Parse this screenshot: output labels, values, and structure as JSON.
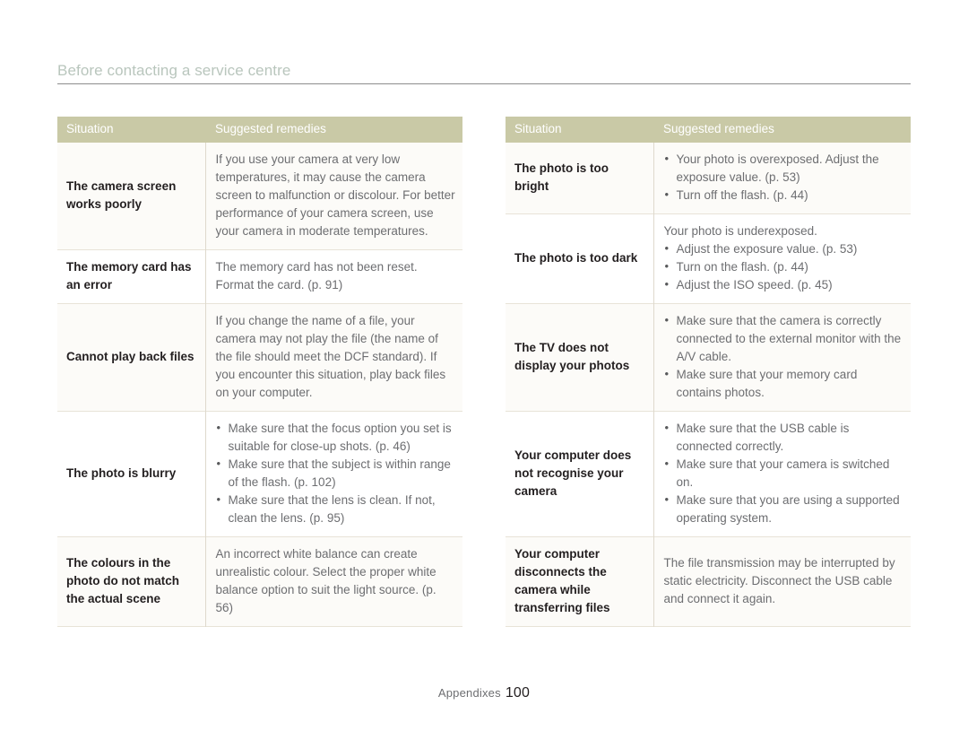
{
  "header": {
    "title": "Before contacting a service centre",
    "rule_color": "#8c8c8c",
    "title_color": "#b9c6bd"
  },
  "theme": {
    "table_header_bg": "#c9c9a6",
    "table_header_text": "#ffffff",
    "situation_text": "#231f20",
    "remedy_text": "#6d6e71",
    "row_divider": "#e8e3d8",
    "alt_row_bg": "#fcfbf8"
  },
  "tables": [
    {
      "id": "left-table",
      "columns": [
        "Situation",
        "Suggested remedies"
      ],
      "rows": [
        {
          "situation": "The camera screen works poorly",
          "remedy_lead": "If you use your camera at very low temperatures, it may cause the camera screen to malfunction or discolour. For better performance of your camera screen, use your camera in moderate temperatures.",
          "remedy_bullets": []
        },
        {
          "situation": "The memory card has an error",
          "remedy_lead": "The memory card has not been reset. Format the card. (p. 91)",
          "remedy_bullets": []
        },
        {
          "situation": "Cannot play back files",
          "remedy_lead": "If you change the name of a file, your camera may not play the file (the name of the file should meet the DCF standard). If you encounter this situation, play back files on your computer.",
          "remedy_bullets": []
        },
        {
          "situation": "The photo is blurry",
          "remedy_lead": "",
          "remedy_bullets": [
            "Make sure that the focus option you set is suitable for close-up shots. (p. 46)",
            "Make sure that the subject is within range of the flash. (p. 102)",
            "Make sure that the lens is clean. If not, clean the lens. (p. 95)"
          ]
        },
        {
          "situation": "The colours in the photo do not match the actual scene",
          "remedy_lead": "An incorrect white balance can create unrealistic colour. Select the proper white balance option to suit the light source. (p. 56)",
          "remedy_bullets": []
        }
      ]
    },
    {
      "id": "right-table",
      "columns": [
        "Situation",
        "Suggested remedies"
      ],
      "rows": [
        {
          "situation": "The photo is too bright",
          "remedy_lead": "",
          "remedy_bullets": [
            "Your photo is overexposed. Adjust the exposure value. (p. 53)",
            "Turn off the flash. (p. 44)"
          ]
        },
        {
          "situation": "The photo is too dark",
          "remedy_lead": "Your photo is underexposed.",
          "remedy_bullets": [
            "Adjust the exposure value. (p. 53)",
            "Turn on the flash. (p. 44)",
            "Adjust the ISO speed. (p. 45)"
          ]
        },
        {
          "situation": "The TV does not display your photos",
          "remedy_lead": "",
          "remedy_bullets": [
            "Make sure that the camera is correctly connected to the external monitor with the A/V cable.",
            "Make sure that your memory card contains photos."
          ]
        },
        {
          "situation": "Your computer does not recognise your camera",
          "remedy_lead": "",
          "remedy_bullets": [
            "Make sure that the USB cable is connected correctly.",
            "Make sure that your camera is switched on.",
            "Make sure that you are using a supported operating system."
          ]
        },
        {
          "situation": "Your computer disconnects the camera while transferring files",
          "remedy_lead": "The file transmission may be interrupted by static electricity. Disconnect the USB cable and connect it again.",
          "remedy_bullets": []
        }
      ]
    }
  ],
  "footer": {
    "label": "Appendixes",
    "page_number": "100"
  }
}
